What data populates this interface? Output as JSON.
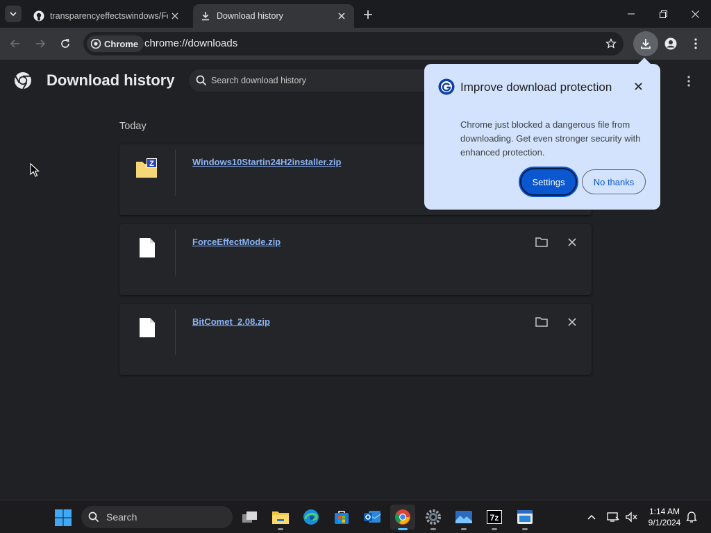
{
  "browser": {
    "tabs": [
      {
        "title": "transparencyeffectswindows/Fo",
        "favicon": "github-icon",
        "active": false
      },
      {
        "title": "Download history",
        "favicon": "download-icon",
        "active": true
      }
    ],
    "omnibox": {
      "chip_label": "Chrome",
      "url": "chrome://downloads"
    }
  },
  "downloads": {
    "title": "Download history",
    "search_placeholder": "Search download history",
    "section_label": "Today",
    "items": [
      {
        "name": "Windows10Startin24H2installer.zip",
        "icon": "zip-folder-icon"
      },
      {
        "name": "ForceEffectMode.zip",
        "icon": "file-icon"
      },
      {
        "name": "BitComet_2.08.zip",
        "icon": "file-icon"
      }
    ]
  },
  "popup": {
    "title": "Improve download protection",
    "body": "Chrome just blocked a dangerous file from downloading. Get even stronger security with enhanced protection.",
    "primary_button": "Settings",
    "secondary_button": "No thanks"
  },
  "taskbar": {
    "search_label": "Search",
    "time": "1:14 AM",
    "date": "9/1/2024"
  },
  "colors": {
    "background": "#202124",
    "link": "#8ab4f8",
    "popup_bg": "#d3e3fd",
    "accent": "#0b57d0"
  }
}
